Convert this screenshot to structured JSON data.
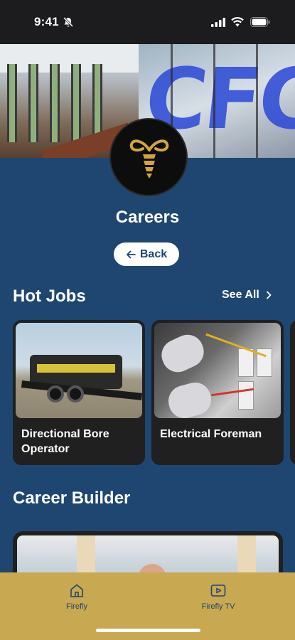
{
  "status_bar": {
    "time": "9:41"
  },
  "page": {
    "title": "Careers",
    "back_label": "Back"
  },
  "hero": {
    "sign_letters": "CFC"
  },
  "hot_jobs": {
    "title": "Hot Jobs",
    "see_all_label": "See All",
    "items": [
      {
        "label": "Directional Bore Operator"
      },
      {
        "label": "Electrical Foreman"
      }
    ]
  },
  "career_builder": {
    "title": "Career Builder"
  },
  "tab_bar": {
    "items": [
      {
        "label": "Firefly",
        "icon": "home-icon"
      },
      {
        "label": "Firefly TV",
        "icon": "tv-play-icon"
      }
    ]
  },
  "colors": {
    "background": "#1f4670",
    "card": "#202020",
    "accent_gold": "#c8a851",
    "logo_gold": "#d3a63a"
  }
}
